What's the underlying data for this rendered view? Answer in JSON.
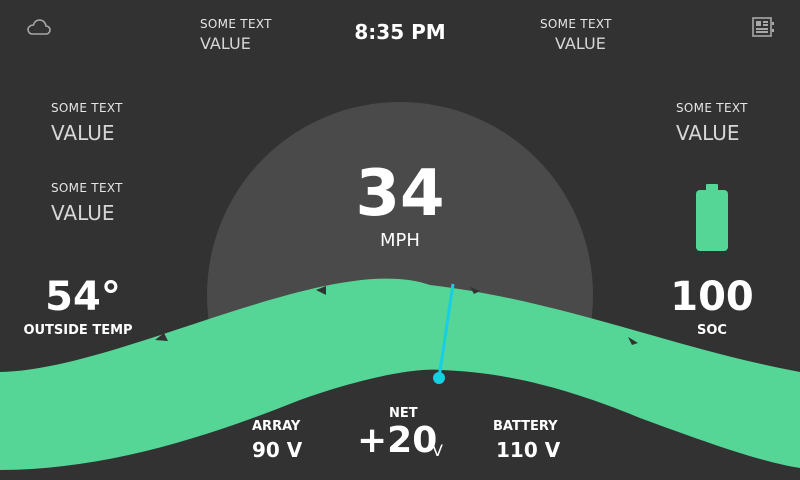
{
  "header": {
    "time": "8:35 PM",
    "left_field": {
      "label": "SOME TEXT",
      "value": "VALUE"
    },
    "right_field": {
      "label": "SOME TEXT",
      "value": "VALUE"
    }
  },
  "left_panel": {
    "fields": [
      {
        "label": "SOME TEXT",
        "value": "VALUE"
      },
      {
        "label": "SOME TEXT",
        "value": "VALUE"
      }
    ],
    "temperature": {
      "value": "54°",
      "label": "OUTSIDE TEMP"
    }
  },
  "right_panel": {
    "field": {
      "label": "SOME TEXT",
      "value": "VALUE"
    },
    "battery_icon": "battery-full-icon",
    "soc": {
      "value": "100",
      "label": "SOC"
    },
    "soc_level": 1.0
  },
  "speedometer": {
    "speed": "34",
    "unit": "MPH"
  },
  "bottom": {
    "array": {
      "label": "ARRAY",
      "value": "90 V"
    },
    "net": {
      "label": "NET",
      "value": "+20",
      "unit": "V"
    },
    "battery": {
      "label": "BATTERY",
      "value": "110 V"
    }
  },
  "icons": {
    "top_left": "cloud-icon",
    "top_right": "dashboard-icon"
  },
  "colors": {
    "background": "#323232",
    "dial": "#4a4a4a",
    "accent_green": "#55d596",
    "needle": "#17cfe3"
  }
}
